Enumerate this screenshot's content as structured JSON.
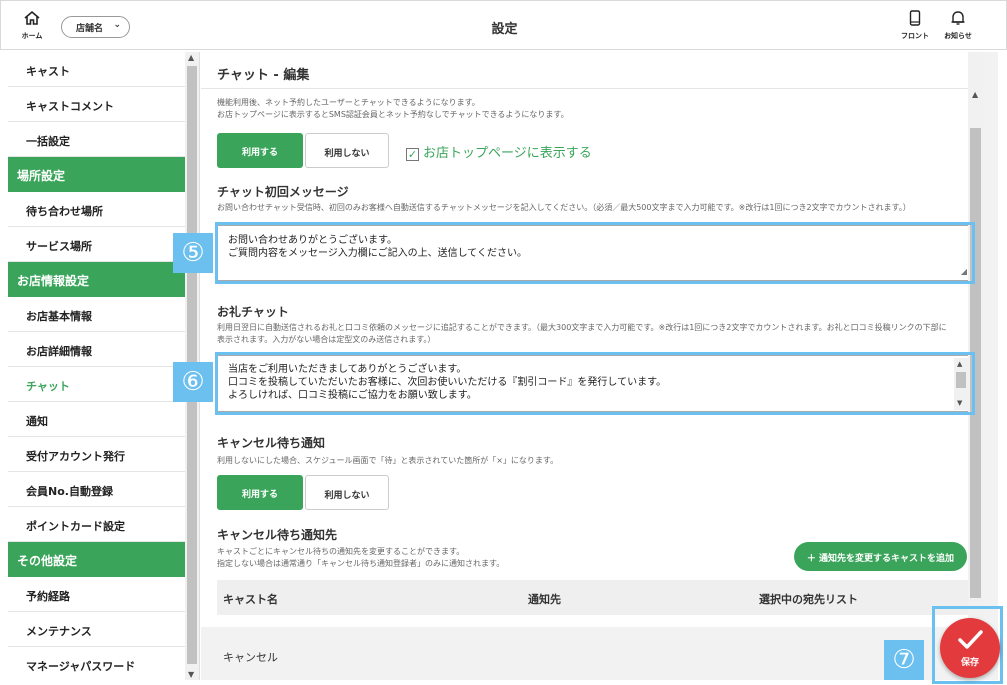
{
  "header": {
    "home_label": "ホーム",
    "store_select_value": "店舗名",
    "title": "設定",
    "front_label": "フロント",
    "notice_label": "お知らせ"
  },
  "sidebar": {
    "items": [
      {
        "type": "item",
        "label": "キャスト"
      },
      {
        "type": "item",
        "label": "キャストコメント"
      },
      {
        "type": "item",
        "label": "一括設定"
      },
      {
        "type": "section",
        "label": "場所設定"
      },
      {
        "type": "item",
        "label": "待ち合わせ場所"
      },
      {
        "type": "item",
        "label": "サービス場所"
      },
      {
        "type": "section",
        "label": "お店情報設定"
      },
      {
        "type": "item",
        "label": "お店基本情報"
      },
      {
        "type": "item",
        "label": "お店詳細情報"
      },
      {
        "type": "item",
        "label": "チャット",
        "active": true
      },
      {
        "type": "item",
        "label": "通知"
      },
      {
        "type": "item",
        "label": "受付アカウント発行"
      },
      {
        "type": "item",
        "label": "会員No.自動登録"
      },
      {
        "type": "item",
        "label": "ポイントカード設定"
      },
      {
        "type": "section",
        "label": "その他設定"
      },
      {
        "type": "item",
        "label": "予約経路"
      },
      {
        "type": "item",
        "label": "メンテナンス"
      },
      {
        "type": "item",
        "label": "マネージャパスワード"
      }
    ]
  },
  "main": {
    "title": "チャット - 編集",
    "chat_usage": {
      "desc_line1": "機能利用後、ネット予約したユーザーとチャットできるようになります。",
      "desc_line2": "お店トップページに表示するとSMS認証会員とネット予約なしでチャットできるようになります。",
      "use_label": "利用する",
      "not_use_label": "利用しない",
      "show_top_label": "お店トップページに表示する"
    },
    "first_message": {
      "title": "チャット初回メッセージ",
      "desc": "お問い合わせチャット受信時、初回のみお客様へ自動送信するチャットメッセージを記入してください。（必須／最大500文字まで入力可能です。※改行は1回につき2文字でカウントされます。）",
      "value_line1": "お問い合わせありがとうございます。",
      "value_line2": "ご質問内容をメッセージ入力欄にご記入の上、送信してください。"
    },
    "thanks_chat": {
      "title": "お礼チャット",
      "desc_line1": "利用日翌日に自動送信されるお礼と口コミ依頼のメッセージに追記することができます。（最大300文字まで入力可能です。※改行は1回につき2文字でカウントされます。お礼と口コミ投稿リンクの下部に",
      "desc_line2": "表示されます。入力がない場合は定型文のみ送信されます。）",
      "value_line1": "当店をご利用いただきましてありがとうございます。",
      "value_line2": "口コミを投稿していただいたお客様に、次回お使いいただける『割引コード』を発行しています。",
      "value_line3": "よろしければ、口コミ投稿にご協力をお願い致します。"
    },
    "cancel_wait": {
      "title": "キャンセル待ち通知",
      "desc": "利用しないにした場合、スケジュール画面で「待」と表示されていた箇所が「×」になります。",
      "use_label": "利用する",
      "not_use_label": "利用しない"
    },
    "cancel_dest": {
      "title": "キャンセル待ち通知先",
      "desc_line1": "キャストごとにキャンセル待ちの通知先を変更することができます。",
      "desc_line2": "指定しない場合は通常通り「キャンセル待ち通知登録者」のみに通知されます。",
      "add_button": "＋ 通知先を変更するキャストを追加",
      "columns": [
        "キャスト名",
        "通知先",
        "選択中の宛先リスト"
      ]
    },
    "cancel_label": "キャンセル"
  },
  "save_label": "保存",
  "markers": [
    "⑤",
    "⑥",
    "⑦"
  ],
  "colors": {
    "accent_green": "#3aa55a",
    "save_red": "#e23a3d",
    "marker_blue": "#6cc0ef"
  }
}
